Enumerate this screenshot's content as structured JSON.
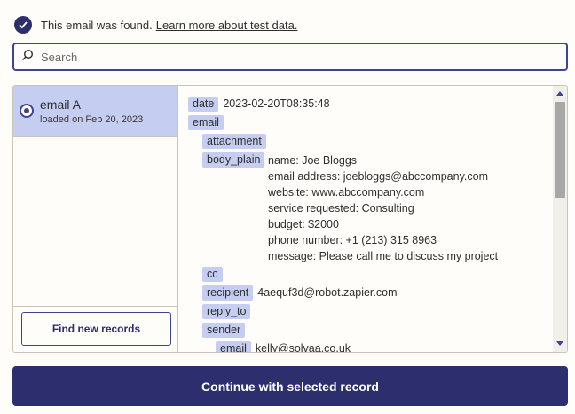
{
  "notice": {
    "text": "This email was found.",
    "link": "Learn more about test data."
  },
  "search": {
    "placeholder": "Search"
  },
  "records": [
    {
      "name": "email A",
      "loaded": "loaded on Feb 20, 2023",
      "selected": true
    }
  ],
  "find_button": "Find new records",
  "detail": {
    "date_key": "date",
    "date_value": "2023-02-20T08:35:48",
    "email_key": "email",
    "attachment_key": "attachment",
    "body_plain_key": "body_plain",
    "body_plain_lines": [
      "name: Joe Bloggs",
      "email address: joebloggs@abccompany.com",
      "website: www.abccompany.com",
      "service requested: Consulting",
      "budget: $2000",
      "phone number: +1 (213) 315 8963",
      "message: Please call me to discuss my project"
    ],
    "cc_key": "cc",
    "recipient_key": "recipient",
    "recipient_value": "4aequf3d@robot.zapier.com",
    "reply_to_key": "reply_to",
    "sender_key": "sender",
    "sender_email_key": "email",
    "sender_email_value": "kelly@solvaa.co.uk"
  },
  "continue_button": "Continue with selected record"
}
